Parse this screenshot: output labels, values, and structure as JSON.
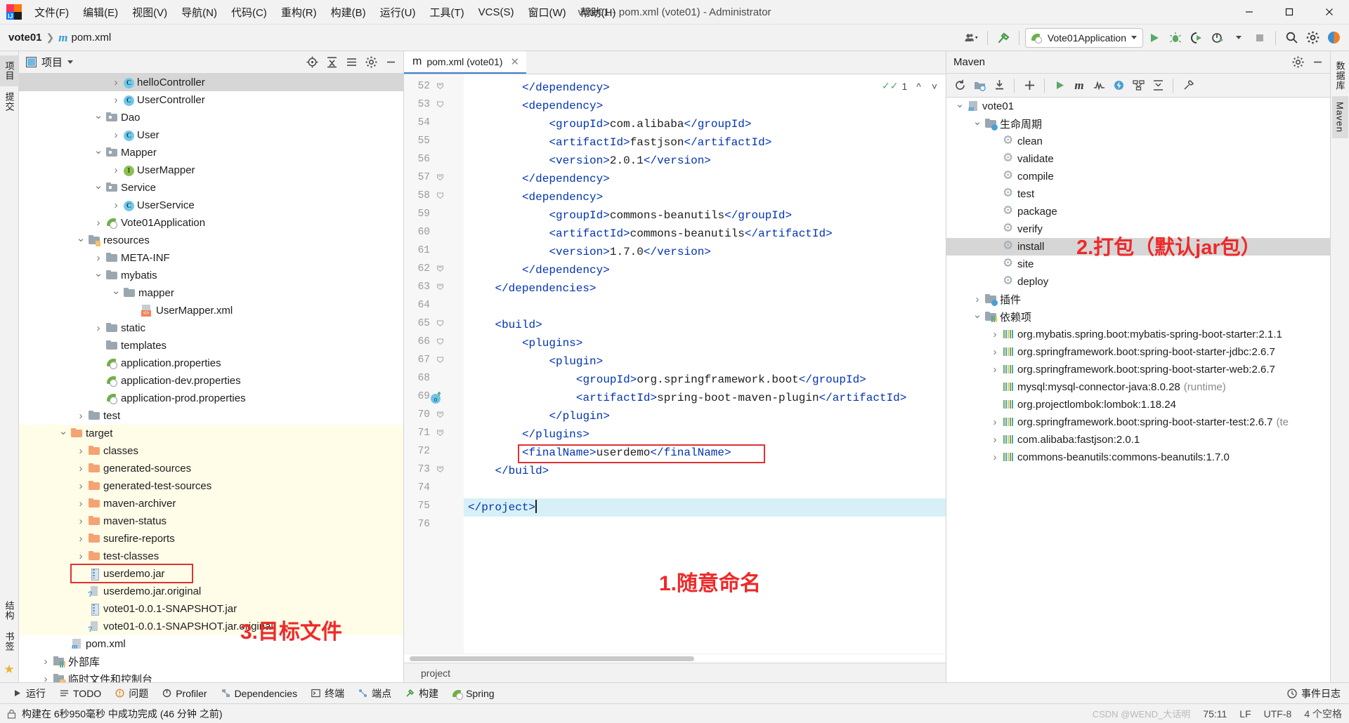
{
  "window": {
    "title": "vote01 - pom.xml (vote01) - Administrator",
    "logo_label": "IJ",
    "minimize_icon": "minimize-icon",
    "maximize_icon": "maximize-icon",
    "close_icon": "close-icon"
  },
  "menubar": [
    {
      "label": "文件(F)"
    },
    {
      "label": "编辑(E)"
    },
    {
      "label": "视图(V)"
    },
    {
      "label": "导航(N)"
    },
    {
      "label": "代码(C)"
    },
    {
      "label": "重构(R)"
    },
    {
      "label": "构建(B)"
    },
    {
      "label": "运行(U)"
    },
    {
      "label": "工具(T)"
    },
    {
      "label": "VCS(S)"
    },
    {
      "label": "窗口(W)"
    },
    {
      "label": "帮助(H)"
    }
  ],
  "navbar": {
    "breadcrumb": [
      "vote01",
      "pom.xml"
    ],
    "run_config": "Vote01Application",
    "icons": [
      "person-dropdown-icon",
      "hammer-icon",
      "run-icon",
      "debug-icon",
      "run-with-coverage-icon",
      "profiler-icon",
      "stop-icon",
      "search-icon",
      "settings-icon",
      "updates-icon"
    ]
  },
  "left_strip": {
    "tabs": [
      "项目",
      "提交"
    ],
    "bottom_tabs": [
      "结构",
      "书签"
    ]
  },
  "right_strip": {
    "tabs": [
      "数据库",
      "Maven"
    ]
  },
  "project_panel": {
    "title": "项目",
    "header_icons": [
      "locate-icon",
      "collapse-all-icon",
      "expand-icon",
      "settings-icon",
      "hide-icon"
    ],
    "tree": [
      {
        "label": "helloController",
        "indent": 5,
        "arrow": "right",
        "icon": "class-icon",
        "selected": true
      },
      {
        "label": "UserController",
        "indent": 5,
        "arrow": "right",
        "icon": "class-icon"
      },
      {
        "label": "Dao",
        "indent": 4,
        "arrow": "down",
        "icon": "package-icon"
      },
      {
        "label": "User",
        "indent": 5,
        "arrow": "right",
        "icon": "class-icon"
      },
      {
        "label": "Mapper",
        "indent": 4,
        "arrow": "down",
        "icon": "package-icon"
      },
      {
        "label": "UserMapper",
        "indent": 5,
        "arrow": "right",
        "icon": "interface-icon"
      },
      {
        "label": "Service",
        "indent": 4,
        "arrow": "down",
        "icon": "package-icon"
      },
      {
        "label": "UserService",
        "indent": 5,
        "arrow": "right",
        "icon": "class-icon"
      },
      {
        "label": "Vote01Application",
        "indent": 4,
        "arrow": "right",
        "icon": "spring-class-icon"
      },
      {
        "label": "resources",
        "indent": 3,
        "arrow": "down",
        "icon": "resources-folder-icon"
      },
      {
        "label": "META-INF",
        "indent": 4,
        "arrow": "right",
        "icon": "folder-icon"
      },
      {
        "label": "mybatis",
        "indent": 4,
        "arrow": "down",
        "icon": "folder-icon"
      },
      {
        "label": "mapper",
        "indent": 5,
        "arrow": "down",
        "icon": "folder-icon"
      },
      {
        "label": "UserMapper.xml",
        "indent": 6,
        "arrow": "none",
        "icon": "xml-file-icon"
      },
      {
        "label": "static",
        "indent": 4,
        "arrow": "right",
        "icon": "folder-icon"
      },
      {
        "label": "templates",
        "indent": 4,
        "arrow": "none",
        "icon": "folder-icon"
      },
      {
        "label": "application.properties",
        "indent": 4,
        "arrow": "none",
        "icon": "spring-properties-icon"
      },
      {
        "label": "application-dev.properties",
        "indent": 4,
        "arrow": "none",
        "icon": "spring-properties-icon"
      },
      {
        "label": "application-prod.properties",
        "indent": 4,
        "arrow": "none",
        "icon": "spring-properties-icon"
      },
      {
        "label": "test",
        "indent": 3,
        "arrow": "right",
        "icon": "folder-icon"
      },
      {
        "label": "target",
        "indent": 2,
        "arrow": "down",
        "icon": "orange-folder-icon",
        "target": true
      },
      {
        "label": "classes",
        "indent": 3,
        "arrow": "right",
        "icon": "orange-folder-icon",
        "target": true
      },
      {
        "label": "generated-sources",
        "indent": 3,
        "arrow": "right",
        "icon": "orange-folder-icon",
        "target": true
      },
      {
        "label": "generated-test-sources",
        "indent": 3,
        "arrow": "right",
        "icon": "orange-folder-icon",
        "target": true
      },
      {
        "label": "maven-archiver",
        "indent": 3,
        "arrow": "right",
        "icon": "orange-folder-icon",
        "target": true
      },
      {
        "label": "maven-status",
        "indent": 3,
        "arrow": "right",
        "icon": "orange-folder-icon",
        "target": true
      },
      {
        "label": "surefire-reports",
        "indent": 3,
        "arrow": "right",
        "icon": "orange-folder-icon",
        "target": true
      },
      {
        "label": "test-classes",
        "indent": 3,
        "arrow": "right",
        "icon": "orange-folder-icon",
        "target": true
      },
      {
        "label": "userdemo.jar",
        "indent": 3,
        "arrow": "none",
        "icon": "jar-icon",
        "target": true,
        "boxed": true
      },
      {
        "label": "userdemo.jar.original",
        "indent": 3,
        "arrow": "none",
        "icon": "jar-original-icon",
        "target": true
      },
      {
        "label": "vote01-0.0.1-SNAPSHOT.jar",
        "indent": 3,
        "arrow": "none",
        "icon": "jar-icon",
        "target": true
      },
      {
        "label": "vote01-0.0.1-SNAPSHOT.jar.original",
        "indent": 3,
        "arrow": "none",
        "icon": "jar-original-icon",
        "target": true
      },
      {
        "label": "pom.xml",
        "indent": 2,
        "arrow": "none",
        "icon": "maven-file-icon"
      },
      {
        "label": "外部库",
        "indent": 1,
        "arrow": "right",
        "icon": "external-libraries-icon"
      },
      {
        "label": "临时文件和控制台",
        "indent": 1,
        "arrow": "right",
        "icon": "scratches-icon"
      }
    ]
  },
  "editor": {
    "tab": {
      "label": "pom.xml (vote01)",
      "icon": "maven-file-icon",
      "close_icon": "close-icon"
    },
    "inspection": {
      "count": "1",
      "icon": "inspections-ok-icon"
    },
    "first_line_number": 52,
    "lines": [
      {
        "n": 52,
        "indent": 8,
        "fold": "minus",
        "tokens": [
          {
            "t": "tag",
            "v": "</dependency>"
          }
        ]
      },
      {
        "n": 53,
        "indent": 8,
        "fold": "plus",
        "tokens": [
          {
            "t": "tag",
            "v": "<dependency>"
          }
        ]
      },
      {
        "n": 54,
        "indent": 12,
        "tokens": [
          {
            "t": "tag",
            "v": "<groupId>"
          },
          {
            "t": "txt",
            "v": "com.alibaba"
          },
          {
            "t": "tag",
            "v": "</groupId>"
          }
        ]
      },
      {
        "n": 55,
        "indent": 12,
        "tokens": [
          {
            "t": "tag",
            "v": "<artifactId>"
          },
          {
            "t": "txt",
            "v": "fastjson"
          },
          {
            "t": "tag",
            "v": "</artifactId>"
          }
        ]
      },
      {
        "n": 56,
        "indent": 12,
        "tokens": [
          {
            "t": "tag",
            "v": "<version>"
          },
          {
            "t": "txt",
            "v": "2.0.1"
          },
          {
            "t": "tag",
            "v": "</version>"
          }
        ]
      },
      {
        "n": 57,
        "indent": 8,
        "fold": "minus",
        "tokens": [
          {
            "t": "tag",
            "v": "</dependency>"
          }
        ]
      },
      {
        "n": 58,
        "indent": 8,
        "fold": "plus",
        "tokens": [
          {
            "t": "tag",
            "v": "<dependency>"
          }
        ]
      },
      {
        "n": 59,
        "indent": 12,
        "tokens": [
          {
            "t": "tag",
            "v": "<groupId>"
          },
          {
            "t": "txt",
            "v": "commons-beanutils"
          },
          {
            "t": "tag",
            "v": "</groupId>"
          }
        ]
      },
      {
        "n": 60,
        "indent": 12,
        "tokens": [
          {
            "t": "tag",
            "v": "<artifactId>"
          },
          {
            "t": "txt",
            "v": "commons-beanutils"
          },
          {
            "t": "tag",
            "v": "</artifactId>"
          }
        ]
      },
      {
        "n": 61,
        "indent": 12,
        "tokens": [
          {
            "t": "tag",
            "v": "<version>"
          },
          {
            "t": "txt",
            "v": "1.7.0"
          },
          {
            "t": "tag",
            "v": "</version>"
          }
        ]
      },
      {
        "n": 62,
        "indent": 8,
        "fold": "minus",
        "tokens": [
          {
            "t": "tag",
            "v": "</dependency>"
          }
        ]
      },
      {
        "n": 63,
        "indent": 4,
        "fold": "minus",
        "tokens": [
          {
            "t": "tag",
            "v": "</dependencies>"
          }
        ]
      },
      {
        "n": 64,
        "indent": 4,
        "tokens": []
      },
      {
        "n": 65,
        "indent": 4,
        "fold": "plus",
        "tokens": [
          {
            "t": "tag",
            "v": "<build>"
          }
        ]
      },
      {
        "n": 66,
        "indent": 8,
        "fold": "plus",
        "tokens": [
          {
            "t": "tag",
            "v": "<plugins>"
          }
        ]
      },
      {
        "n": 67,
        "indent": 12,
        "fold": "plus",
        "tokens": [
          {
            "t": "tag",
            "v": "<plugin>"
          }
        ]
      },
      {
        "n": 68,
        "indent": 16,
        "tokens": [
          {
            "t": "tag",
            "v": "<groupId>"
          },
          {
            "t": "txt",
            "v": "org.springframework.boot"
          },
          {
            "t": "tag",
            "v": "</groupId>"
          }
        ]
      },
      {
        "n": 69,
        "indent": 16,
        "marker": "spring-bean-icon",
        "tokens": [
          {
            "t": "tag",
            "v": "<artifactId>"
          },
          {
            "t": "txt",
            "v": "spring-boot-maven-plugin"
          },
          {
            "t": "tag",
            "v": "</artifactId>"
          }
        ]
      },
      {
        "n": 70,
        "indent": 12,
        "fold": "minus",
        "tokens": [
          {
            "t": "tag",
            "v": "</plugin>"
          }
        ]
      },
      {
        "n": 71,
        "indent": 8,
        "fold": "minus",
        "tokens": [
          {
            "t": "tag",
            "v": "</plugins>"
          }
        ]
      },
      {
        "n": 72,
        "indent": 8,
        "boxed": true,
        "tokens": [
          {
            "t": "tag",
            "v": "<finalName>"
          },
          {
            "t": "txt",
            "v": "userdemo"
          },
          {
            "t": "tag",
            "v": "</finalName>"
          }
        ]
      },
      {
        "n": 73,
        "indent": 4,
        "fold": "minus",
        "tokens": [
          {
            "t": "tag",
            "v": "</build>"
          }
        ]
      },
      {
        "n": 74,
        "indent": 4,
        "tokens": []
      },
      {
        "n": 75,
        "indent": 0,
        "highlight": true,
        "caret": true,
        "tokens": [
          {
            "t": "tag",
            "v": "</project>"
          }
        ]
      },
      {
        "n": 76,
        "indent": 0,
        "tokens": []
      }
    ],
    "breadcrumb": "project"
  },
  "maven_panel": {
    "title": "Maven",
    "toolbar_icons": [
      "reload-icon",
      "add-maven-project-icon",
      "download-sources-icon",
      "add-icon",
      "run-icon",
      "execute-maven-goal-icon",
      "toggle-skip-tests-icon",
      "offline-mode-icon",
      "show-diagram-icon",
      "expand-icon",
      "collapse-icon",
      "settings-icon"
    ],
    "header_icons": [
      "settings-icon",
      "hide-icon"
    ],
    "tree": [
      {
        "label": "vote01",
        "indent": 0,
        "arrow": "down",
        "icon": "maven-project-icon"
      },
      {
        "label": "生命周期",
        "indent": 1,
        "arrow": "down",
        "icon": "lifecycle-folder-icon"
      },
      {
        "label": "clean",
        "indent": 2,
        "arrow": "none",
        "icon": "maven-goal-icon"
      },
      {
        "label": "validate",
        "indent": 2,
        "arrow": "none",
        "icon": "maven-goal-icon"
      },
      {
        "label": "compile",
        "indent": 2,
        "arrow": "none",
        "icon": "maven-goal-icon"
      },
      {
        "label": "test",
        "indent": 2,
        "arrow": "none",
        "icon": "maven-goal-icon"
      },
      {
        "label": "package",
        "indent": 2,
        "arrow": "none",
        "icon": "maven-goal-icon"
      },
      {
        "label": "verify",
        "indent": 2,
        "arrow": "none",
        "icon": "maven-goal-icon"
      },
      {
        "label": "install",
        "indent": 2,
        "arrow": "none",
        "icon": "maven-goal-icon",
        "selected": true
      },
      {
        "label": "site",
        "indent": 2,
        "arrow": "none",
        "icon": "maven-goal-icon"
      },
      {
        "label": "deploy",
        "indent": 2,
        "arrow": "none",
        "icon": "maven-goal-icon"
      },
      {
        "label": "插件",
        "indent": 1,
        "arrow": "right",
        "icon": "plugins-folder-icon"
      },
      {
        "label": "依赖项",
        "indent": 1,
        "arrow": "down",
        "icon": "dependencies-folder-icon"
      },
      {
        "label": "org.mybatis.spring.boot:mybatis-spring-boot-starter:2.1.1",
        "indent": 2,
        "arrow": "right",
        "icon": "library-icon"
      },
      {
        "label": "org.springframework.boot:spring-boot-starter-jdbc:2.6.7",
        "indent": 2,
        "arrow": "right",
        "icon": "library-icon"
      },
      {
        "label": "org.springframework.boot:spring-boot-starter-web:2.6.7",
        "indent": 2,
        "arrow": "right",
        "icon": "library-icon"
      },
      {
        "label": "mysql:mysql-connector-java:8.0.28",
        "suffix": "(runtime)",
        "indent": 2,
        "arrow": "none",
        "icon": "library-icon"
      },
      {
        "label": "org.projectlombok:lombok:1.18.24",
        "indent": 2,
        "arrow": "none",
        "icon": "library-icon"
      },
      {
        "label": "org.springframework.boot:spring-boot-starter-test:2.6.7",
        "suffix": "(te",
        "indent": 2,
        "arrow": "right",
        "icon": "library-icon"
      },
      {
        "label": "com.alibaba:fastjson:2.0.1",
        "indent": 2,
        "arrow": "right",
        "icon": "library-icon"
      },
      {
        "label": "commons-beanutils:commons-beanutils:1.7.0",
        "indent": 2,
        "arrow": "right",
        "icon": "library-icon"
      }
    ]
  },
  "annotations": [
    {
      "id": "anno-1",
      "text": "1.随意命名",
      "color": "#ef2929"
    },
    {
      "id": "anno-2",
      "text": "2.打包（默认jar包）",
      "color": "#ef2929"
    },
    {
      "id": "anno-3",
      "text": "3.目标文件",
      "color": "#ef2929"
    }
  ],
  "bottom_toolbar": [
    {
      "label": "运行",
      "icon": "run-icon"
    },
    {
      "label": "TODO",
      "icon": "todo-icon"
    },
    {
      "label": "问题",
      "icon": "problems-icon"
    },
    {
      "label": "Profiler",
      "icon": "profiler-icon"
    },
    {
      "label": "Dependencies",
      "icon": "dependencies-icon"
    },
    {
      "label": "终端",
      "icon": "terminal-icon"
    },
    {
      "label": "端点",
      "icon": "endpoints-icon"
    },
    {
      "label": "构建",
      "icon": "build-icon"
    },
    {
      "label": "Spring",
      "icon": "spring-icon"
    }
  ],
  "bottom_right": [
    {
      "label": "事件日志",
      "icon": "event-log-icon"
    }
  ],
  "statusbar": {
    "message": "构建在 6秒950毫秒 中成功完成 (46 分钟 之前)",
    "caret_position": "75:11",
    "line_separator": "LF",
    "encoding": "UTF-8",
    "indent": "4 个空格",
    "watermark": "CSDN @WEND_大话明",
    "lock_icon": "lock-icon"
  }
}
